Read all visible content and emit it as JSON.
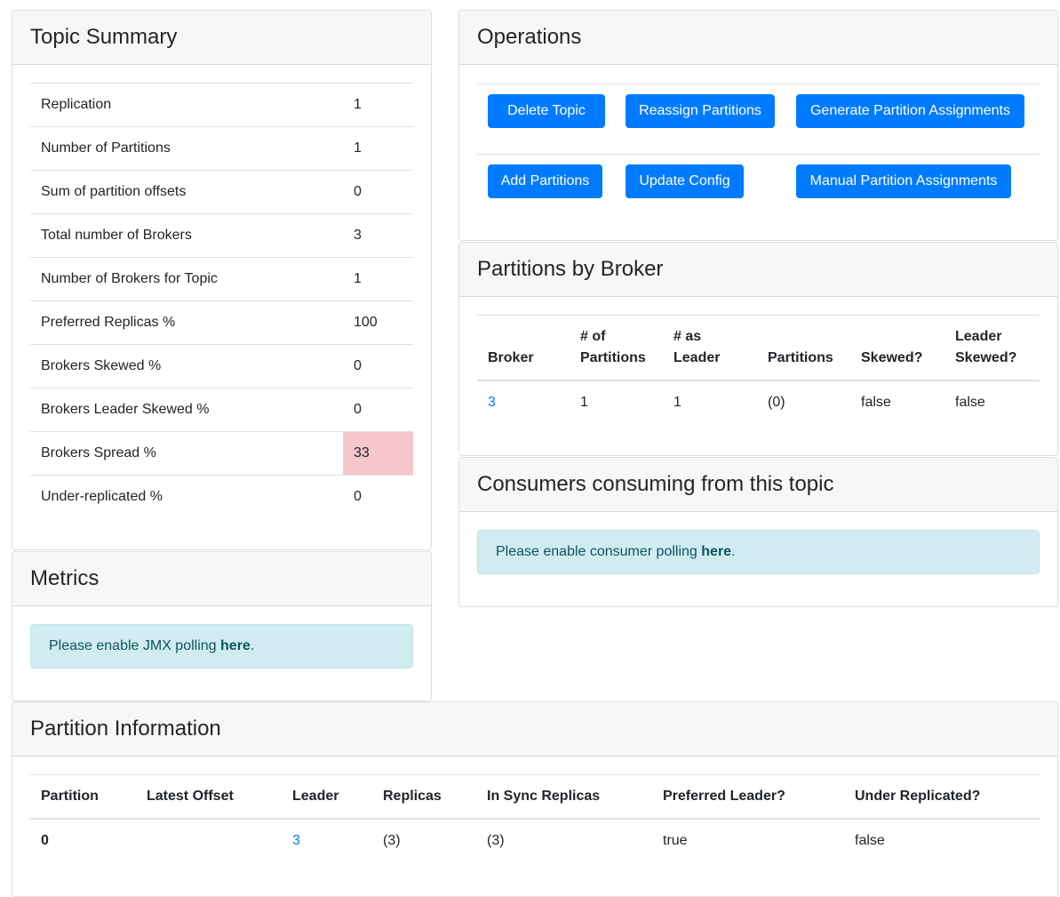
{
  "topic_summary": {
    "title": "Topic Summary",
    "rows": [
      {
        "label": "Replication",
        "value": "1"
      },
      {
        "label": "Number of Partitions",
        "value": "1"
      },
      {
        "label": "Sum of partition offsets",
        "value": "0"
      },
      {
        "label": "Total number of Brokers",
        "value": "3"
      },
      {
        "label": "Number of Brokers for Topic",
        "value": "1"
      },
      {
        "label": "Preferred Replicas %",
        "value": "100"
      },
      {
        "label": "Brokers Skewed %",
        "value": "0"
      },
      {
        "label": "Brokers Leader Skewed %",
        "value": "0"
      },
      {
        "label": "Brokers Spread %",
        "value": "33"
      },
      {
        "label": "Under-replicated %",
        "value": "0"
      }
    ],
    "highlight_color": "#f5c6cb"
  },
  "operations": {
    "title": "Operations",
    "delete_topic": "Delete Topic",
    "reassign_partitions": "Reassign Partitions",
    "generate_assignments": "Generate Partition Assignments",
    "add_partitions": "Add Partitions",
    "update_config": "Update Config",
    "manual_assignments": "Manual Partition Assignments",
    "button_color": "#007bff"
  },
  "partitions_by_broker": {
    "title": "Partitions by Broker",
    "headers": {
      "broker": "Broker",
      "num_partitions_1": "# of",
      "num_partitions_2": "Partitions",
      "as_leader_1": "# as",
      "as_leader_2": "Leader",
      "partitions": "Partitions",
      "skewed": "Skewed?",
      "leader_skewed_1": "Leader",
      "leader_skewed_2": "Skewed?"
    },
    "rows": [
      {
        "broker": "3",
        "num_partitions": "1",
        "as_leader": "1",
        "partitions": "(0)",
        "skewed": "false",
        "leader_skewed": "false"
      }
    ]
  },
  "consumers": {
    "title": "Consumers consuming from this topic",
    "alert_text": "Please enable consumer polling ",
    "alert_link": "here",
    "alert_end": "."
  },
  "metrics": {
    "title": "Metrics",
    "alert_text": "Please enable JMX polling ",
    "alert_link": "here",
    "alert_end": "."
  },
  "partition_information": {
    "title": "Partition Information",
    "headers": {
      "partition": "Partition",
      "latest_offset": "Latest Offset",
      "leader": "Leader",
      "replicas": "Replicas",
      "isr": "In Sync Replicas",
      "preferred_leader": "Preferred Leader?",
      "under_replicated": "Under Replicated?"
    },
    "rows": [
      {
        "partition": "0",
        "latest_offset": "",
        "leader": "3",
        "replicas": "(3)",
        "isr": "(3)",
        "preferred_leader": "true",
        "under_replicated": "false"
      }
    ]
  }
}
